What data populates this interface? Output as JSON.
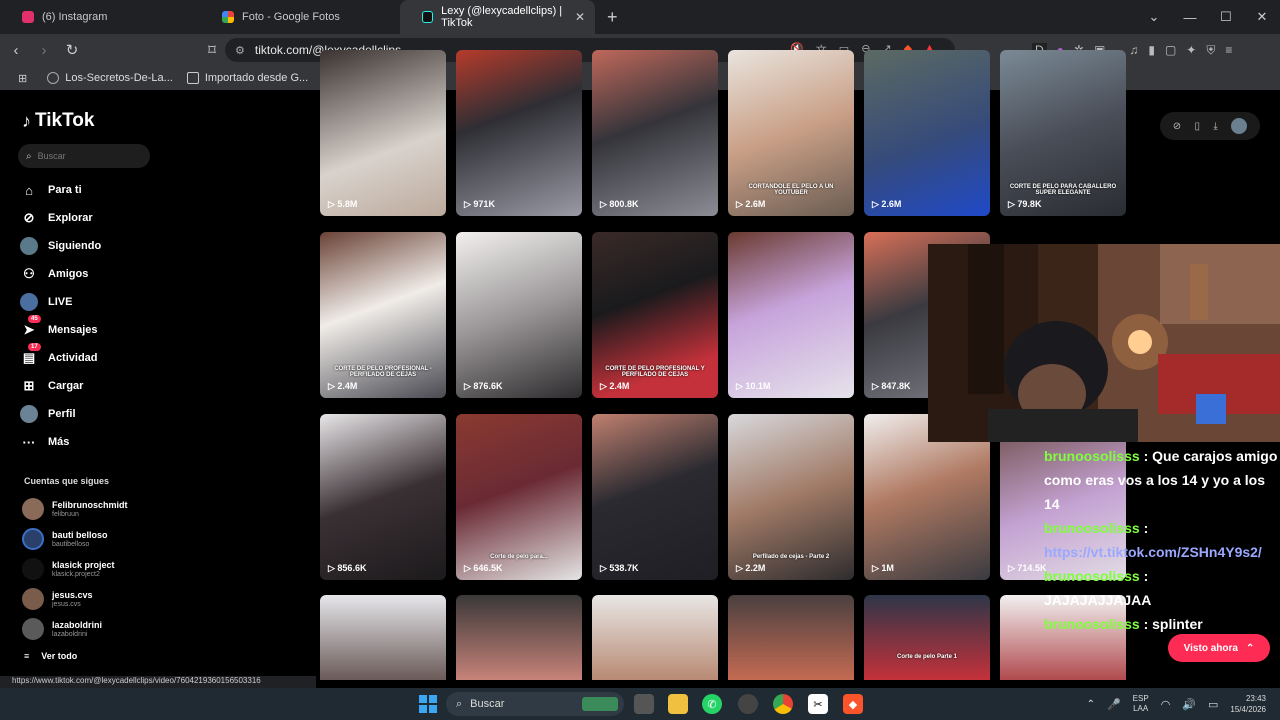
{
  "browser": {
    "tabs": [
      {
        "label": "(6) Instagram",
        "color": "#e1306c"
      },
      {
        "label": "Foto - Google Fotos",
        "color": "#fbbc04"
      },
      {
        "label": "Lexy (@lexycadellclips) | TikTok",
        "color": "#111111"
      }
    ],
    "url": "tiktok.com/@lexycadellclips",
    "bookmarks": [
      "Los-Secretos-De-La...",
      "Importado desde G..."
    ],
    "status_url": "https://www.tiktok.com/@lexycadellclips/video/7604219360156503316"
  },
  "sidebar": {
    "logo": "TikTok",
    "search_placeholder": "Buscar",
    "nav": [
      {
        "label": "Para ti",
        "icon": "home-icon"
      },
      {
        "label": "Explorar",
        "icon": "compass-icon"
      },
      {
        "label": "Siguiendo",
        "icon": "following-avatar-icon"
      },
      {
        "label": "Amigos",
        "icon": "friends-icon"
      },
      {
        "label": "LIVE",
        "icon": "live-avatar-icon"
      },
      {
        "label": "Mensajes",
        "icon": "messages-icon",
        "badge": "45"
      },
      {
        "label": "Actividad",
        "icon": "activity-icon",
        "badge": "17"
      },
      {
        "label": "Cargar",
        "icon": "upload-icon"
      },
      {
        "label": "Perfil",
        "icon": "profile-avatar-icon"
      },
      {
        "label": "Más",
        "icon": "more-icon"
      }
    ],
    "following_title": "Cuentas que sigues",
    "following": [
      {
        "name": "Felibrunoschmidt",
        "handle": "felibruun"
      },
      {
        "name": "bauti belloso",
        "handle": "bautibelloso"
      },
      {
        "name": "klasick project",
        "handle": "klasick.project2"
      },
      {
        "name": "jesus.cvs",
        "handle": "jesus.cvs"
      },
      {
        "name": "lazaboldrini",
        "handle": "lazaboldrini"
      }
    ],
    "see_all": "Ver todo"
  },
  "videos": {
    "row1": [
      {
        "views": "5.8M",
        "caption": ""
      },
      {
        "views": "971K",
        "caption": ""
      },
      {
        "views": "800.8K",
        "caption": ""
      },
      {
        "views": "2.6M",
        "caption": "CORTANDOLE EL PELO A UN YOUTUBER"
      },
      {
        "views": "2.6M",
        "caption": ""
      },
      {
        "views": "79.8K",
        "caption": "CORTE DE PELO PARA CABALLERO SUPER ELEGANTE"
      }
    ],
    "row2": [
      {
        "views": "2.4M",
        "caption": "CORTE DE PELO PROFESIONAL - PERFILADO DE CEJAS"
      },
      {
        "views": "876.6K",
        "caption": ""
      },
      {
        "views": "2.4M",
        "caption": "CORTE DE PELO PROFESIONAL Y PERFILADO DE CEJAS"
      },
      {
        "views": "10.1M",
        "caption": ""
      },
      {
        "views": "847.8K",
        "caption": ""
      }
    ],
    "row3": [
      {
        "views": "856.6K",
        "caption": ""
      },
      {
        "views": "646.5K",
        "caption": "Corte de pelo para..."
      },
      {
        "views": "538.7K",
        "caption": ""
      },
      {
        "views": "2.2M",
        "caption": "Perfilado de cejas - Parte 2"
      },
      {
        "views": "1M",
        "caption": ""
      },
      {
        "views": "714.5K",
        "caption": ""
      }
    ],
    "row4": [
      {
        "views": "",
        "caption": ""
      },
      {
        "views": "",
        "caption": ""
      },
      {
        "views": "",
        "caption": ""
      },
      {
        "views": "",
        "caption": ""
      },
      {
        "views": "",
        "caption": "Corte de pelo Parte 1"
      },
      {
        "views": "",
        "caption": ""
      }
    ]
  },
  "chat": [
    {
      "user": "brunoosolisss",
      "msg": "Que carajos amigo como eras vos a los 14 y yo a los 14"
    },
    {
      "user": "brunoosolisss",
      "link": "https://vt.tiktok.com/ZSHn4Y9s2/"
    },
    {
      "user": "brunoosolisss",
      "msg": "JAJAJAJJAJAA"
    },
    {
      "user": "brunoosolisss",
      "msg": "splinter"
    }
  ],
  "visto_ahora": "Visto ahora",
  "taskbar": {
    "search": "Buscar",
    "lang_top": "ESP",
    "lang_bottom": "LAA",
    "time": "23:43",
    "date": "15/4/2026"
  }
}
